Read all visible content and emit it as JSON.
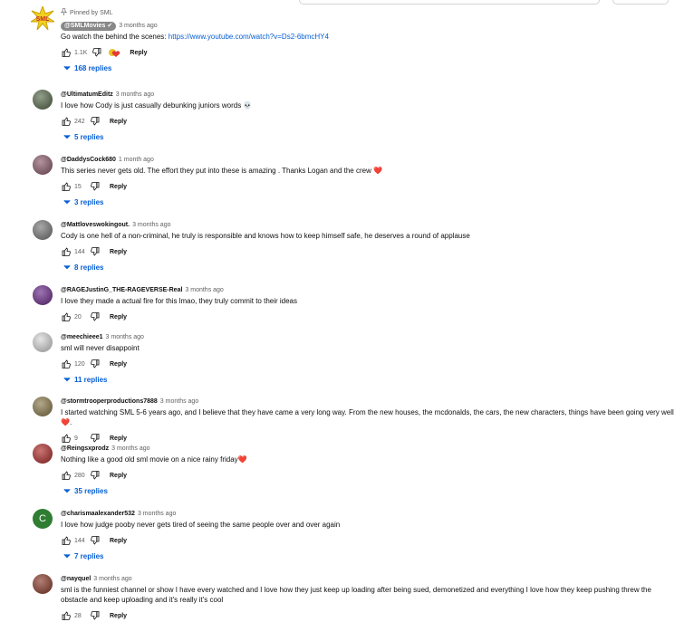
{
  "comments": [
    {
      "pinned": "Pinned by SML",
      "author": "@SMLMovies",
      "verified": true,
      "time": "3 months ago",
      "text": "Go watch the behind the scenes: ",
      "link": "https://www.youtube.com/watch?v=Ds2-6bmcHY4",
      "likes": "1.1K",
      "reply": "Reply",
      "replies": "168 replies",
      "avatar_color": "#e7c323"
    },
    {
      "author": "@UltimatumEditz",
      "time": "3 months ago",
      "text": "I love how Cody is just casually debunking juniors words 💀",
      "likes": "242",
      "reply": "Reply",
      "replies": "5 replies",
      "avatar_color": "#5a6b4c"
    },
    {
      "author": "@DaddysCock680",
      "time": "1 month ago",
      "text": "This series never gets old. The effort they put into these is amazing . Thanks Logan and the crew ",
      "heart": "❤️",
      "likes": "15",
      "reply": "Reply",
      "replies": "3 replies",
      "avatar_color": "#8a5a6b"
    },
    {
      "author": "@Mattloveswokingout.",
      "time": "3 months ago",
      "text": "Cody is one hell of a non-criminal, he truly is responsible and knows how to keep himself safe, he deserves a round of applause",
      "likes": "144",
      "reply": "Reply",
      "replies": "8 replies",
      "avatar_color": "#7a7a7a"
    },
    {
      "author": "@RAGEJustinG_THE-RAGEVERSE-Real",
      "time": "3 months ago",
      "text": "I love they made a actual fire for this lmao, they truly commit to their ideas",
      "likes": "20",
      "reply": "Reply",
      "replies": "",
      "avatar_color": "#6a2a8a"
    },
    {
      "author": "@meechieee1",
      "time": "3 months ago",
      "text": "sml will never disappoint",
      "likes": "120",
      "reply": "Reply",
      "replies": "11 replies",
      "avatar_color": "#d8d8d8"
    },
    {
      "author": "@stormtrooperproductions7888",
      "time": "3 months ago",
      "text": "I started watching SML 5-6 years ago, and I believe that they have came a very long way.  From the new houses, the mcdonalds, the cars, the new characters, things have been going very well ",
      "heart": "❤️",
      "text_after": ".",
      "likes": "9",
      "reply": "Reply",
      "replies": "",
      "avatar_color": "#8a7a4a"
    },
    {
      "author": "@Reingsxprodz",
      "time": "3 months ago",
      "text": "Nothing like a good old sml movie on a nice rainy friday",
      "heart": "❤️",
      "likes": "280",
      "reply": "Reply",
      "replies": "35 replies",
      "avatar_color": "#b02a2a"
    },
    {
      "author": "@charismaalexander532",
      "time": "3 months ago",
      "text": "I love how judge pooby never gets tired of seeing the same people over and over again",
      "likes": "144",
      "reply": "Reply",
      "replies": "7 replies",
      "avatar_color": "#2e7d32",
      "avatar_letter": "C"
    },
    {
      "author": "@nayquel",
      "time": "3 months ago",
      "text": "sml is the funniest channel or show I have every watched  and I love how they just keep up loading after being sued, demonetized and everything I love how they keep pushing threw the obstacle and keep uploading and it's really it's  cool",
      "likes": "28",
      "reply": "Reply",
      "replies": "",
      "avatar_color": "#8a3a2a"
    }
  ],
  "icons": {
    "like": "thumbs-up-icon",
    "dislike": "thumbs-down-icon",
    "pin": "pin-icon",
    "expand": "chevron-down-icon",
    "verified": "verified-check-icon"
  }
}
